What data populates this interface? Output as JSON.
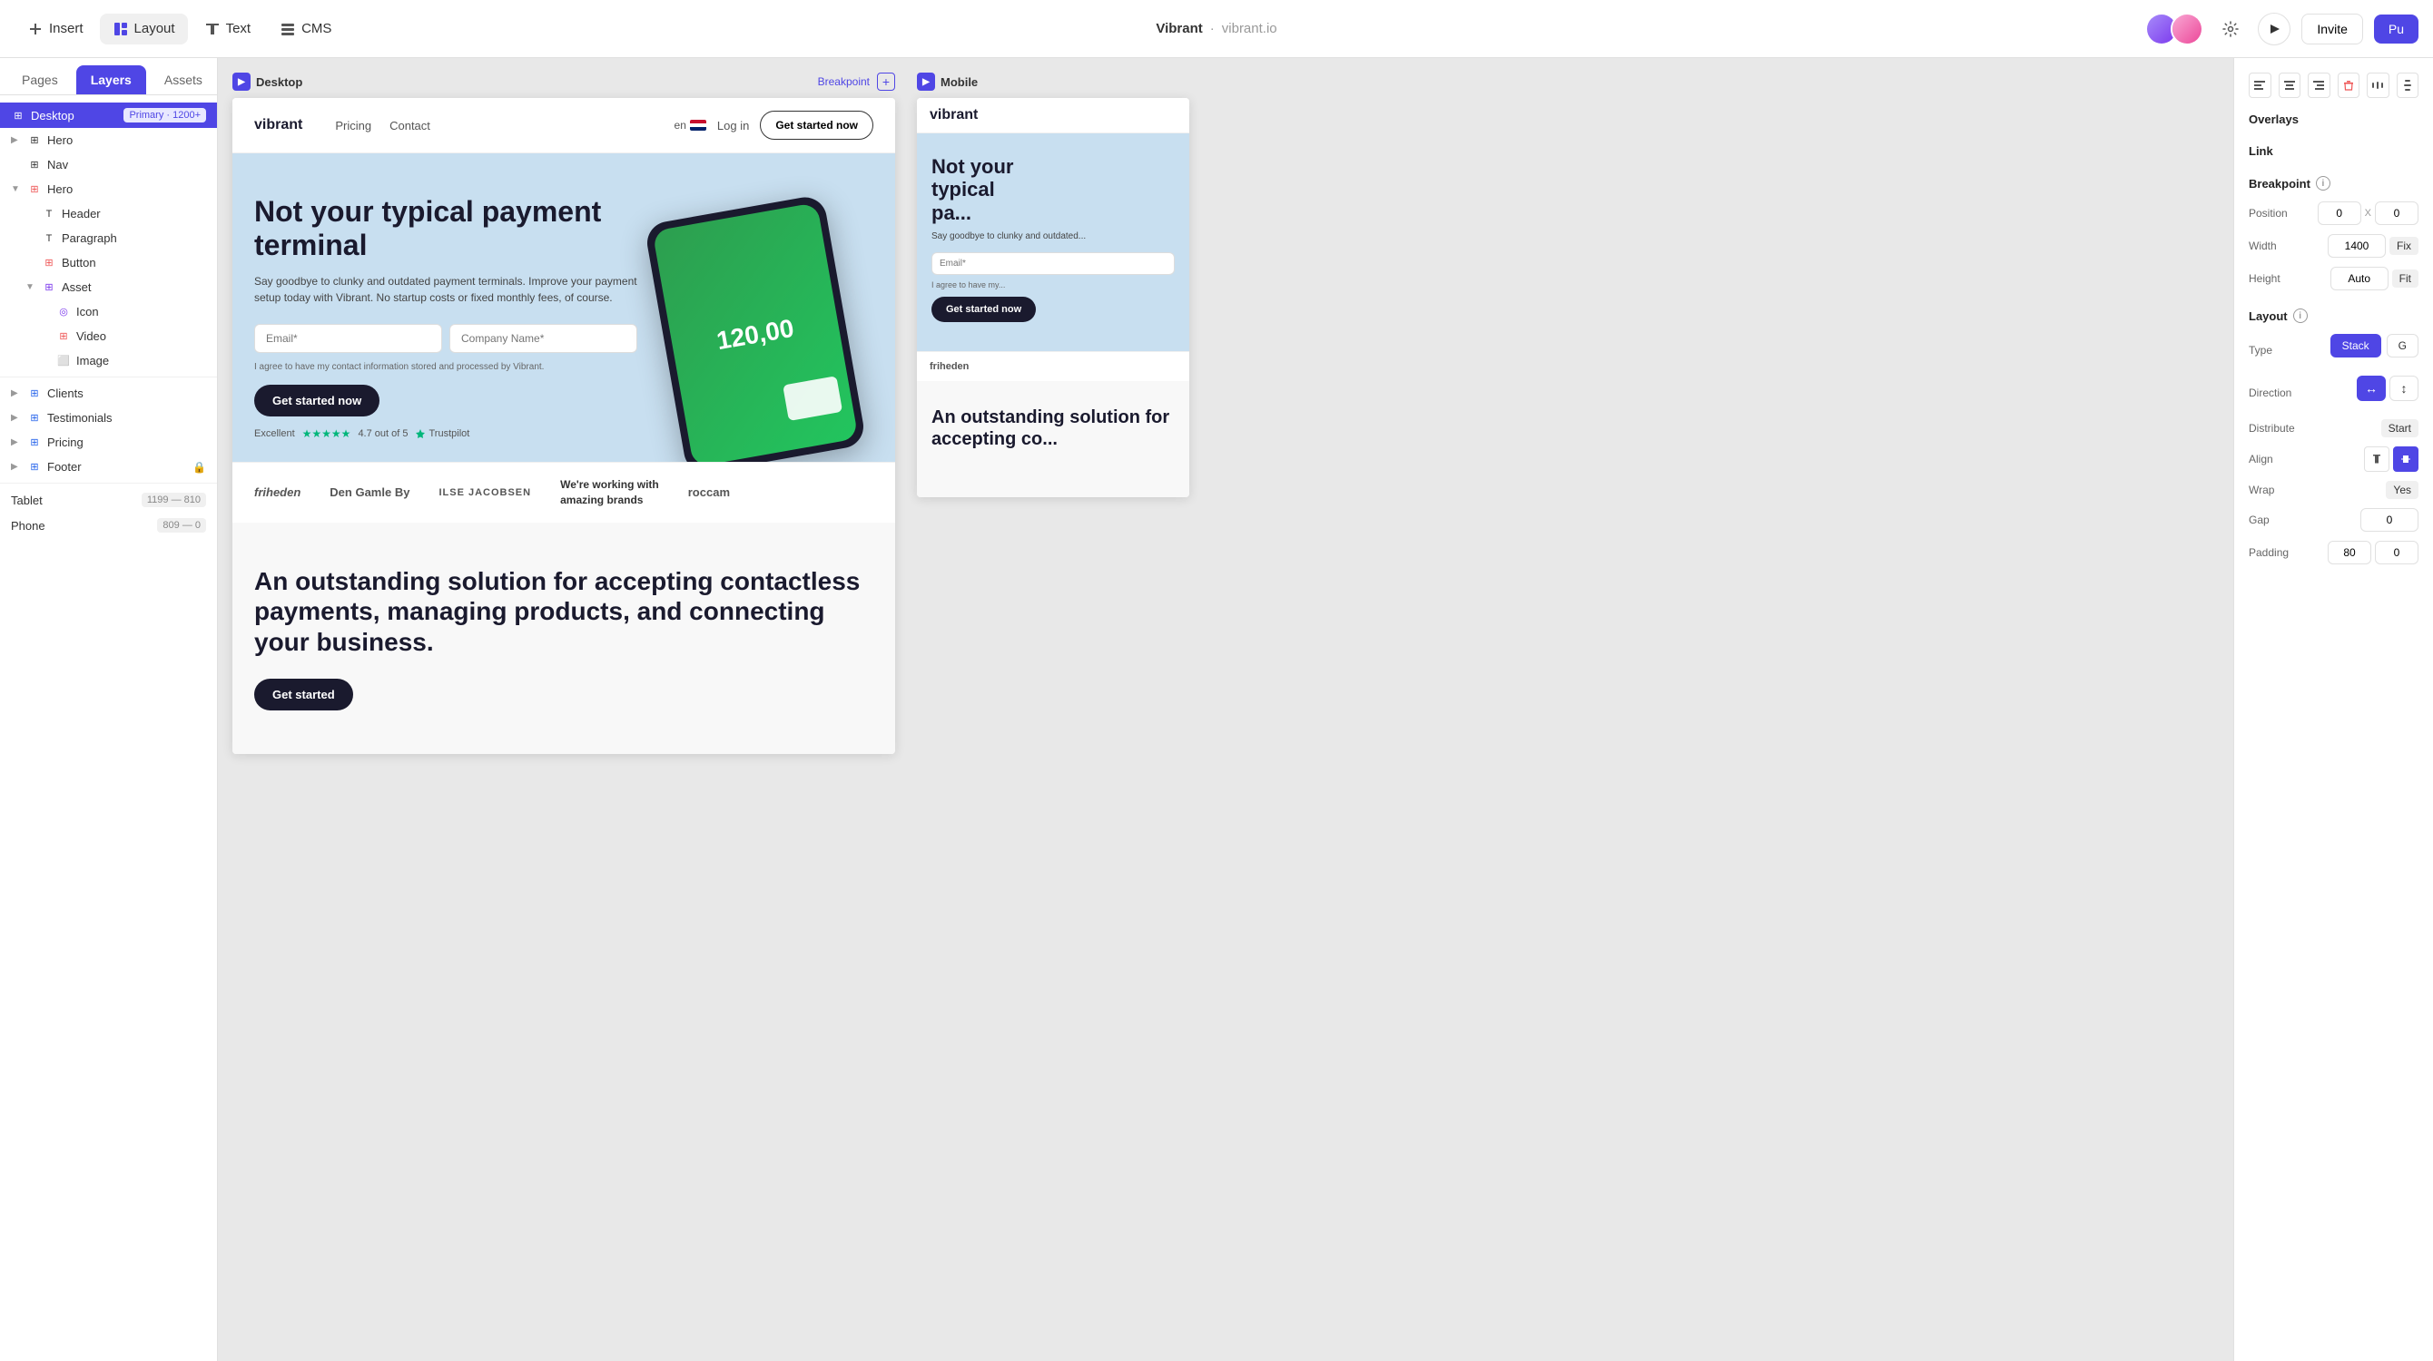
{
  "toolbar": {
    "insert_label": "Insert",
    "layout_label": "Layout",
    "text_label": "Text",
    "cms_label": "CMS",
    "project_name": "Vibrant",
    "project_url": "vibrant.io",
    "invite_label": "Invite",
    "pu_label": "Pu"
  },
  "left_panel": {
    "tabs": [
      {
        "id": "pages",
        "label": "Pages"
      },
      {
        "id": "layers",
        "label": "Layers"
      },
      {
        "id": "assets",
        "label": "Assets"
      }
    ],
    "active_tab": "layers",
    "desktop_label": "Desktop",
    "desktop_badge": "Primary · 1200+",
    "layers": [
      {
        "id": "hero",
        "label": "Hero",
        "level": 0,
        "icon": "⊞",
        "has_expand": false
      },
      {
        "id": "nav",
        "label": "Nav",
        "level": 0,
        "icon": "⊞",
        "has_expand": false
      },
      {
        "id": "hero2",
        "label": "Hero",
        "level": 0,
        "icon": "⊞",
        "has_expand": true,
        "expanded": true
      },
      {
        "id": "header",
        "label": "Header",
        "level": 1,
        "icon": "T",
        "has_expand": false
      },
      {
        "id": "paragraph",
        "label": "Paragraph",
        "level": 1,
        "icon": "T",
        "has_expand": false
      },
      {
        "id": "button",
        "label": "Button",
        "level": 1,
        "icon": "⊞",
        "has_expand": false
      },
      {
        "id": "asset",
        "label": "Asset",
        "level": 1,
        "icon": "⊞",
        "has_expand": true,
        "expanded": true
      },
      {
        "id": "icon",
        "label": "Icon",
        "level": 2,
        "icon": "◎",
        "has_expand": false
      },
      {
        "id": "video",
        "label": "Video",
        "level": 2,
        "icon": "⊞",
        "has_expand": false
      },
      {
        "id": "image",
        "label": "Image",
        "level": 2,
        "icon": "⬜",
        "has_expand": false
      },
      {
        "id": "clients",
        "label": "Clients",
        "level": 0,
        "icon": "⊞",
        "has_expand": false
      },
      {
        "id": "testimonials",
        "label": "Testimonials",
        "level": 0,
        "icon": "⊞",
        "has_expand": false
      },
      {
        "id": "pricing",
        "label": "Pricing",
        "level": 0,
        "icon": "⊞",
        "has_expand": false
      },
      {
        "id": "footer",
        "label": "Footer",
        "level": 0,
        "icon": "⊞",
        "has_expand": false,
        "locked": true
      }
    ],
    "breakpoints": [
      {
        "id": "tablet",
        "label": "Tablet",
        "size": "1199 — 810"
      },
      {
        "id": "phone",
        "label": "Phone",
        "size": "809 — 0"
      }
    ]
  },
  "desktop_frame": {
    "title": "Desktop",
    "breakpoint_label": "Breakpoint",
    "site": {
      "logo": "vibrant",
      "nav_links": [
        "Pricing",
        "Contact"
      ],
      "lang": "en",
      "login": "Log in",
      "cta": "Get started now",
      "hero_title": "Not your typical payment terminal",
      "hero_subtitle": "Say goodbye to clunky and outdated payment terminals. Improve your payment setup today with Vibrant. No startup costs or fixed monthly fees, of course.",
      "email_placeholder": "Email*",
      "company_placeholder": "Company Name*",
      "agree_text": "I agree to have my contact information stored and processed by Vibrant.",
      "cta_button": "Get started now",
      "tp_excellent": "Excellent",
      "tp_rating": "4.7 out of 5",
      "tp_brand": "Trustpilot",
      "phone_amount": "120,00",
      "clients": [
        "friheden",
        "Den Gamle By",
        "ILSE JACOBSEN",
        "We're working with amazing brands",
        "roccam"
      ],
      "section_title": "An outstanding solution for accepting contactless payments, managing products, and connecting your business."
    }
  },
  "mobile_frame": {
    "title": "Mobile",
    "site": {
      "logo": "vibrant",
      "hero_title": "Not your typical pa",
      "hero_subtitle": "Say good..."
    }
  },
  "right_panel": {
    "overlays_label": "Overlays",
    "link_label": "Link",
    "breakpoint_label": "Breakpoint",
    "position_label": "Position",
    "position_x": "0",
    "position_y": "0",
    "x_label": "X",
    "width_label": "Width",
    "width_value": "1400",
    "width_mode": "Fix",
    "height_label": "Height",
    "height_value": "Auto",
    "height_mode": "Fit",
    "layout_label": "Layout",
    "type_label": "Type",
    "type_stack": "Stack",
    "type_grid": "G",
    "direction_label": "Direction",
    "direction_h": "↔",
    "direction_v": "↕",
    "distribute_label": "Distribute",
    "distribute_value": "Start",
    "align_label": "Align",
    "wrap_label": "Wrap",
    "wrap_value": "Yes",
    "gap_label": "Gap",
    "gap_value": "0",
    "padding_label": "Padding",
    "padding_bottom": "80",
    "padding_right": "0",
    "top_icons": [
      "⬡",
      "⬡",
      "⬡",
      "🗑",
      "⬡",
      "⬡"
    ]
  }
}
